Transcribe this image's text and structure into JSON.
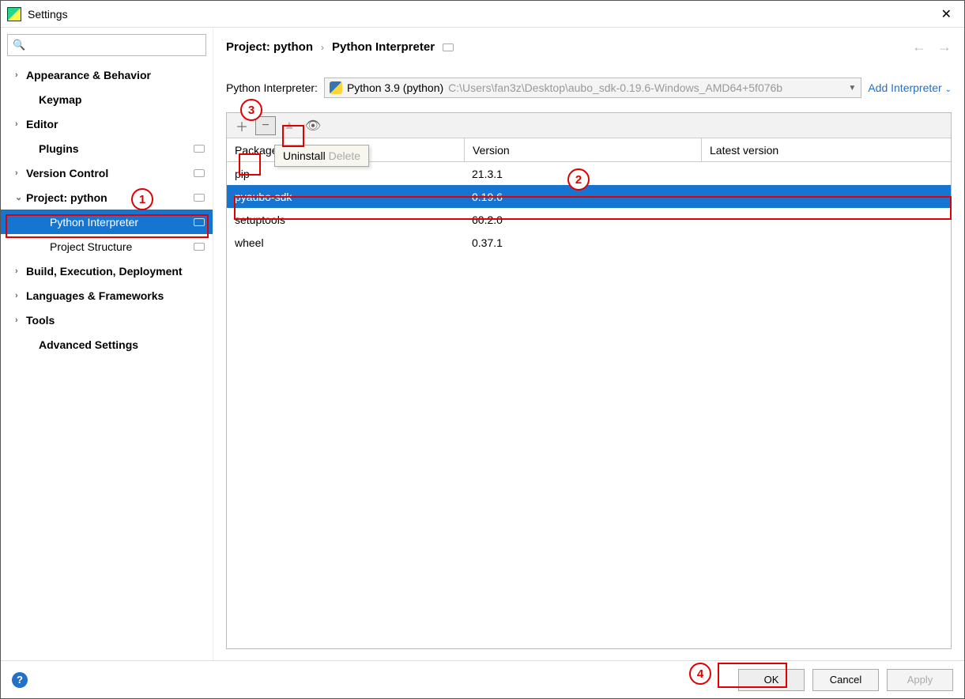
{
  "window": {
    "title": "Settings"
  },
  "search": {
    "placeholder": ""
  },
  "sidebar": {
    "items": [
      {
        "label": "Appearance & Behavior",
        "kind": "expandable",
        "bold": true
      },
      {
        "label": "Keymap",
        "kind": "leaf",
        "bold": true,
        "indent": "child"
      },
      {
        "label": "Editor",
        "kind": "expandable",
        "bold": true
      },
      {
        "label": "Plugins",
        "kind": "leaf",
        "bold": true,
        "indent": "child",
        "badge": true
      },
      {
        "label": "Version Control",
        "kind": "expandable",
        "bold": true,
        "badge": true
      },
      {
        "label": "Project: python",
        "kind": "expanded",
        "bold": true,
        "badge": true
      },
      {
        "label": "Python Interpreter",
        "kind": "leaf",
        "indent": "grandchild",
        "selected": true,
        "badge": true
      },
      {
        "label": "Project Structure",
        "kind": "leaf",
        "indent": "grandchild",
        "badge": true
      },
      {
        "label": "Build, Execution, Deployment",
        "kind": "expandable",
        "bold": true
      },
      {
        "label": "Languages & Frameworks",
        "kind": "expandable",
        "bold": true
      },
      {
        "label": "Tools",
        "kind": "expandable",
        "bold": true
      },
      {
        "label": "Advanced Settings",
        "kind": "leaf",
        "bold": true,
        "indent": "child"
      }
    ]
  },
  "breadcrumb": {
    "a": "Project: python",
    "b": "Python Interpreter"
  },
  "interpreter": {
    "label": "Python Interpreter:",
    "name": "Python 3.9 (python)",
    "path": "C:\\Users\\fan3z\\Desktop\\aubo_sdk-0.19.6-Windows_AMD64+5f076b",
    "addLabel": "Add Interpreter"
  },
  "tooltip": {
    "action": "Uninstall",
    "shortcut": "Delete"
  },
  "packages": {
    "headers": {
      "name": "Package",
      "version": "Version",
      "latest": "Latest version"
    },
    "rows": [
      {
        "name": "pip",
        "version": "21.3.1",
        "latest": ""
      },
      {
        "name": "pyaubo-sdk",
        "version": "0.19.6",
        "latest": "",
        "selected": true
      },
      {
        "name": "setuptools",
        "version": "60.2.0",
        "latest": ""
      },
      {
        "name": "wheel",
        "version": "0.37.1",
        "latest": ""
      }
    ]
  },
  "footer": {
    "ok": "OK",
    "cancel": "Cancel",
    "apply": "Apply"
  },
  "callouts": {
    "c1": "1",
    "c2": "2",
    "c3": "3",
    "c4": "4"
  }
}
